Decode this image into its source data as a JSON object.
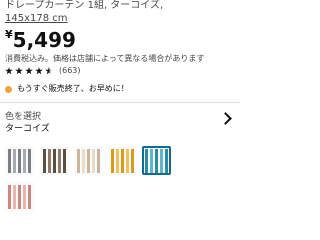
{
  "product": {
    "description": "ドレープカーテン 1組, ターコイズ,",
    "size": "145x178 cm",
    "price_currency": "¥",
    "price_value": "5,499",
    "tax_note": "消費税込み。価格は店舗によって異なる場合があります",
    "rating": {
      "stars": 4.5,
      "max": 5,
      "count": "(663)"
    },
    "availability": "もうすぐ販売終了、お早めに！"
  },
  "color_selector": {
    "label": "色を選択",
    "selected": "ターコイズ",
    "swatches": [
      {
        "name": "gray",
        "colors": [
          "#7b7f84",
          "#a7abaf",
          "#7b7f84",
          "#a7abaf",
          "#7b7f84"
        ],
        "selected": false
      },
      {
        "name": "brown",
        "colors": [
          "#5c4e43",
          "#8b7a6c",
          "#5c4e43",
          "#8b7a6c",
          "#5c4e43"
        ],
        "selected": false
      },
      {
        "name": "beige",
        "colors": [
          "#c8b79e",
          "#e8ddc9",
          "#c8b79e",
          "#e8ddc9",
          "#c8b79e"
        ],
        "selected": false
      },
      {
        "name": "yellow",
        "colors": [
          "#d89a1f",
          "#efc259",
          "#d89a1f",
          "#efc259",
          "#d89a1f"
        ],
        "selected": false
      },
      {
        "name": "turquoise",
        "colors": [
          "#2c8aa3",
          "#5fb6cb",
          "#2c8aa3",
          "#5fb6cb",
          "#2c8aa3"
        ],
        "selected": true
      },
      {
        "name": "pink",
        "colors": [
          "#c9877d",
          "#e7b5ab",
          "#c9877d",
          "#e7b5ab",
          "#c9877d"
        ],
        "selected": false
      }
    ]
  },
  "colors": {
    "availability_dot": "#f2a33a",
    "selected_border": "#0f6c8f"
  }
}
